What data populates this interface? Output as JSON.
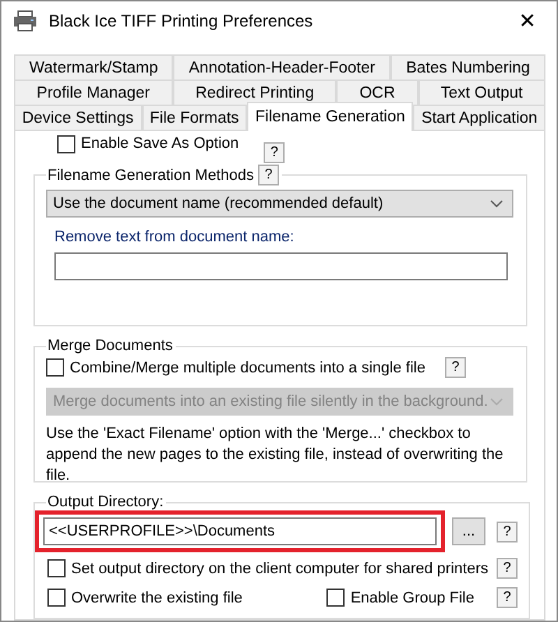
{
  "window": {
    "title": "Black Ice TIFF Printing Preferences",
    "close": "✕"
  },
  "tab_rows": [
    [
      {
        "label": "Watermark/Stamp",
        "selected": false
      },
      {
        "label": "Annotation-Header-Footer",
        "selected": false
      },
      {
        "label": "Bates Numbering",
        "selected": false
      }
    ],
    [
      {
        "label": "Profile Manager",
        "selected": false
      },
      {
        "label": "Redirect Printing",
        "selected": false
      },
      {
        "label": "OCR",
        "selected": false
      },
      {
        "label": "Text Output",
        "selected": false
      }
    ],
    [
      {
        "label": "Device Settings",
        "selected": false
      },
      {
        "label": "File Formats",
        "selected": false
      },
      {
        "label": "Filename Generation",
        "selected": true
      },
      {
        "label": "Start Application",
        "selected": false
      }
    ]
  ],
  "enable_save_as": {
    "label": "Enable Save As Option",
    "checked": false,
    "help": "?"
  },
  "filename_methods": {
    "legend": "Filename Generation Methods",
    "help": "?",
    "dropdown": {
      "value": "Use the document name (recommended default)",
      "disabled": false
    },
    "remove_label": "Remove text from document name:"
  },
  "merge": {
    "legend": "Merge Documents",
    "checkbox": {
      "label": "Combine/Merge multiple documents into a single file",
      "checked": false
    },
    "help": "?",
    "dropdown": {
      "value": "Merge documents into an existing file silently in the background.",
      "disabled": true
    },
    "note": "Use the 'Exact Filename' option with the 'Merge...' checkbox to append the new pages to the existing file, instead of overwriting the file."
  },
  "output": {
    "legend": "Output Directory:",
    "field": {
      "value": "<<USERPROFILE>>\\Documents",
      "highlighted": true
    },
    "browse": "...",
    "help": "?",
    "rows": [
      {
        "checkboxes": [
          {
            "label": "Set output directory on the client computer for shared printers",
            "checked": false
          }
        ],
        "help": "?"
      },
      {
        "checkboxes": [
          {
            "label": "Overwrite the existing file",
            "checked": false
          },
          {
            "label": "Enable Group File",
            "checked": false
          }
        ],
        "help": "?"
      }
    ]
  }
}
